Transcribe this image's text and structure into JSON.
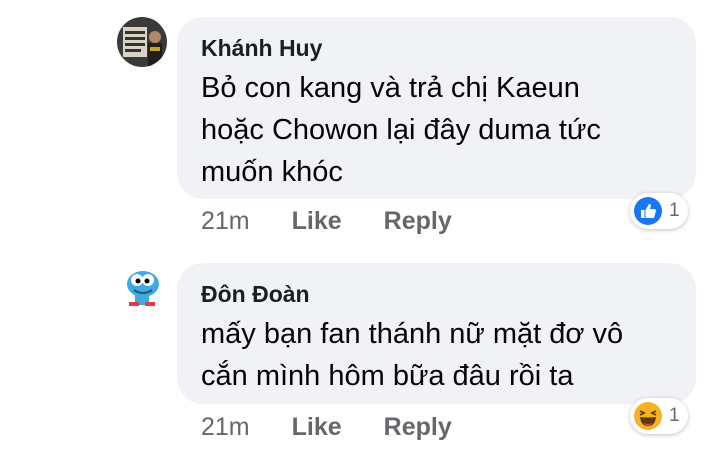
{
  "comments": [
    {
      "author": "Khánh Huy",
      "lines": [
        "Bỏ con kang và trả chị Kaeun",
        "hoặc Chowon lại đây duma tức",
        "muốn khóc"
      ],
      "time": "21m",
      "like": "Like",
      "reply": "Reply",
      "reaction": {
        "icon": "like-icon",
        "count": "1",
        "color": "#1877f2"
      }
    },
    {
      "author": "Đôn Đoàn",
      "lines": [
        "mấy bạn fan thánh nữ mặt đơ vô",
        "cắn mình hôm bữa đâu rồi ta"
      ],
      "time": "21m",
      "like": "Like",
      "reply": "Reply",
      "reaction": {
        "icon": "haha-icon",
        "count": "1",
        "color": "#f7b125"
      }
    }
  ]
}
